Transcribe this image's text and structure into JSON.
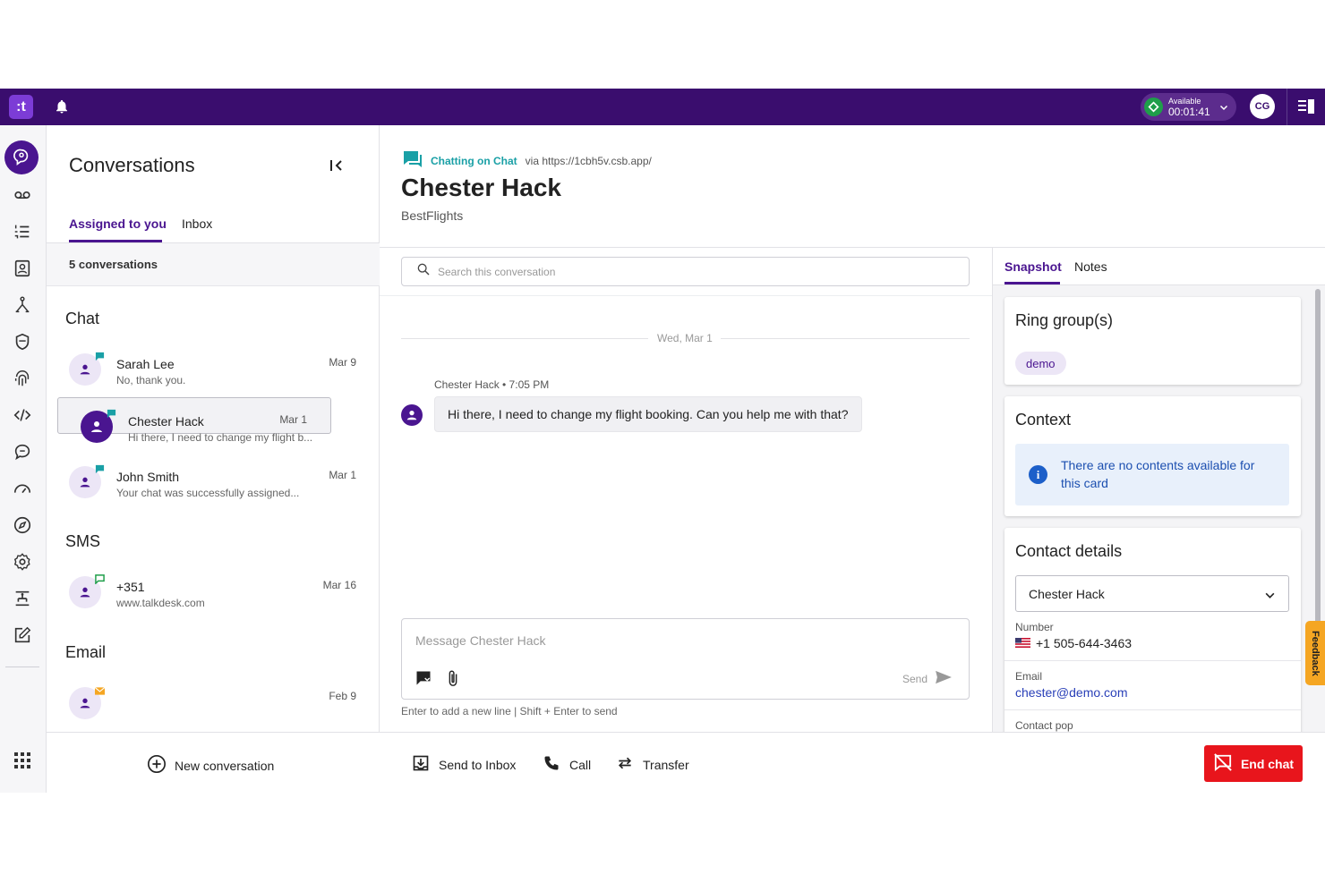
{
  "topbar": {
    "logo_text": ":t",
    "status_label": "Available",
    "status_timer": "00:01:41",
    "user_initials": "CG"
  },
  "left_nav": {
    "icons": [
      "conversations-icon",
      "voicemail-icon",
      "list-icon",
      "contacts-icon",
      "routing-icon",
      "shield-icon",
      "fingerprint-icon",
      "code-icon",
      "chat-bubble-icon",
      "dashboard-icon",
      "compass-icon",
      "settings-icon",
      "people-icon",
      "edit-icon",
      "apps-grid-icon"
    ]
  },
  "conversations": {
    "title": "Conversations",
    "tabs": [
      {
        "label": "Assigned to you"
      },
      {
        "label": "Inbox"
      }
    ],
    "count_text": "5 conversations",
    "sections": {
      "chat": "Chat",
      "sms": "SMS",
      "email": "Email"
    },
    "chat_items": [
      {
        "name": "Sarah Lee",
        "preview": "No, thank you.",
        "date": "Mar 9"
      },
      {
        "name": "Chester Hack",
        "preview": "Hi there, I need to change my flight b...",
        "date": "Mar 1"
      },
      {
        "name": "John Smith",
        "preview": "Your chat was successfully assigned...",
        "date": "Mar 1"
      }
    ],
    "sms_items": [
      {
        "name": "+351",
        "preview": "www.talkdesk.com",
        "date": "Mar 16"
      }
    ],
    "email_items": [
      {
        "name": "",
        "preview": "",
        "date": "Feb 9"
      }
    ],
    "new_conversation": "New conversation"
  },
  "header": {
    "channel_label": "Chatting on Chat",
    "via_text": "via https://1cbh5v.csb.app/",
    "contact_name": "Chester Hack",
    "company": "BestFlights"
  },
  "chat": {
    "search_placeholder": "Search this conversation",
    "day_separator": "Wed, Mar 1",
    "message_meta": "Chester Hack • 7:05 PM",
    "message_text": "Hi there, I need to change my flight booking. Can you help me with that?",
    "composer_placeholder": "Message Chester Hack",
    "send_label": "Send",
    "hint": "Enter to add a new line | Shift + Enter to send"
  },
  "right_panel": {
    "tabs": [
      {
        "label": "Snapshot"
      },
      {
        "label": "Notes"
      }
    ],
    "ring_groups": {
      "title": "Ring group(s)",
      "chip": "demo"
    },
    "context": {
      "title": "Context",
      "info": "There are no contents available for this card"
    },
    "contact_details": {
      "title": "Contact details",
      "selected_contact": "Chester Hack",
      "number_label": "Number",
      "number_value": "+1 505-644-3463",
      "email_label": "Email",
      "email_value": "chester@demo.com",
      "contact_pop_label": "Contact pop"
    },
    "feedback_label": "Feedback"
  },
  "actions": {
    "send_to_inbox": "Send to Inbox",
    "call": "Call",
    "transfer": "Transfer",
    "end_chat": "End chat"
  },
  "colors": {
    "brand_purple": "#3a0d6e",
    "accent_purple": "#4a1590",
    "status_green": "#1f9e4a",
    "end_chat_red": "#e8151c",
    "channel_teal": "#1aa0a6"
  }
}
